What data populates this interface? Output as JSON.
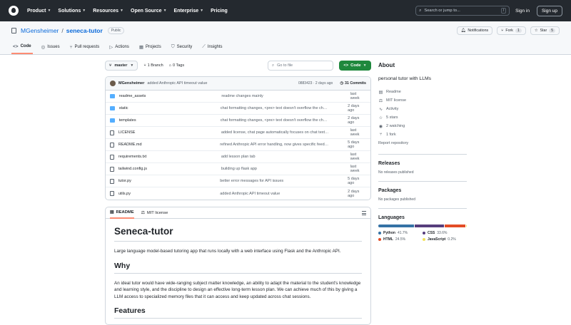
{
  "topbar": {
    "nav": [
      "Product",
      "Solutions",
      "Resources",
      "Open Source",
      "Enterprise",
      "Pricing"
    ],
    "search_placeholder": "Search or jump to...",
    "search_key": "/",
    "sign_in": "Sign in",
    "sign_up": "Sign up"
  },
  "repo": {
    "owner": "MGensheimer",
    "separator": "/",
    "name": "seneca-tutor",
    "visibility": "Public",
    "notifications_label": "Notifications",
    "fork_label": "Fork",
    "fork_count": "1",
    "star_label": "Star",
    "star_count": "5"
  },
  "tabs": [
    {
      "label": "Code",
      "icon": "<>"
    },
    {
      "label": "Issues",
      "icon": "◎"
    },
    {
      "label": "Pull requests",
      "icon": "⑂"
    },
    {
      "label": "Actions",
      "icon": "▷"
    },
    {
      "label": "Projects",
      "icon": "▦"
    },
    {
      "label": "Security",
      "icon": "⛉"
    },
    {
      "label": "Insights",
      "icon": "⟋"
    }
  ],
  "toolbar": {
    "branch": "master",
    "branches": "1 Branch",
    "tags": "0 Tags",
    "goto_placeholder": "Go to file",
    "code_button": "Code"
  },
  "latest_commit": {
    "author": "MGensheimer",
    "message": "added Anthropic API timeout value",
    "meta": "0883423 · 2 days ago",
    "commits": "31 Commits"
  },
  "files": [
    {
      "name": "readme_assets",
      "type": "folder",
      "message": "readme changes mainly",
      "date": "last week"
    },
    {
      "name": "static",
      "type": "folder",
      "message": "chat formatting changes, <pre> text doesn't overflow the ch…",
      "date": "2 days ago"
    },
    {
      "name": "templates",
      "type": "folder",
      "message": "chat formatting changes, <pre> text doesn't overflow the ch…",
      "date": "2 days ago"
    },
    {
      "name": "LICENSE",
      "type": "file",
      "message": "added license, chat page automatically focuses on chat text…",
      "date": "last week"
    },
    {
      "name": "README.md",
      "type": "file",
      "message": "refined Anthropic API error handling, now gives specific feed…",
      "date": "5 days ago"
    },
    {
      "name": "requirements.txt",
      "type": "file",
      "message": "add lesson plan tab",
      "date": "last week"
    },
    {
      "name": "tailwind.config.js",
      "type": "file",
      "message": "building up flask app",
      "date": "last week"
    },
    {
      "name": "tutor.py",
      "type": "file",
      "message": "better error messages for API issues",
      "date": "5 days ago"
    },
    {
      "name": "utils.py",
      "type": "file",
      "message": "added Anthropic API timeout value",
      "date": "2 days ago"
    }
  ],
  "readme": {
    "tab_readme": "README",
    "tab_license": "MIT license",
    "title": "Seneca-tutor",
    "intro": "Large language model-based tutoring app that runs locally with a web interface using Flask and the Anthropic API.",
    "why_heading": "Why",
    "why_text": "An ideal tutor would have wide-ranging subject matter knowledge, an ability to adapt the material to the student's knowledge and learning style, and the discipline to design an effective long-term lesson plan. We can achieve much of this by giving a LLM access to specialized memory files that it can access and keep updated across chat sessions.",
    "features_heading": "Features"
  },
  "about": {
    "title": "About",
    "description": "personal tutor with LLMs",
    "items": [
      {
        "icon": "▤",
        "label": "Readme"
      },
      {
        "icon": "⚖",
        "label": "MIT license"
      },
      {
        "icon": "∿",
        "label": "Activity"
      },
      {
        "icon": "☆",
        "label": "5 stars"
      },
      {
        "icon": "◉",
        "label": "2 watching"
      },
      {
        "icon": "⑂",
        "label": "1 fork"
      }
    ],
    "report": "Report repository"
  },
  "releases": {
    "title": "Releases",
    "text": "No releases published"
  },
  "packages": {
    "title": "Packages",
    "text": "No packages published"
  },
  "languages": {
    "title": "Languages",
    "list": [
      {
        "name": "Python",
        "pct": "41.7%",
        "value": 41.7,
        "color": "#3572A5"
      },
      {
        "name": "CSS",
        "pct": "33.6%",
        "value": 33.6,
        "color": "#563d7c"
      },
      {
        "name": "HTML",
        "pct": "24.5%",
        "value": 24.5,
        "color": "#e34c26"
      },
      {
        "name": "JavaScript",
        "pct": "0.2%",
        "value": 0.2,
        "color": "#f1e05a"
      }
    ]
  }
}
